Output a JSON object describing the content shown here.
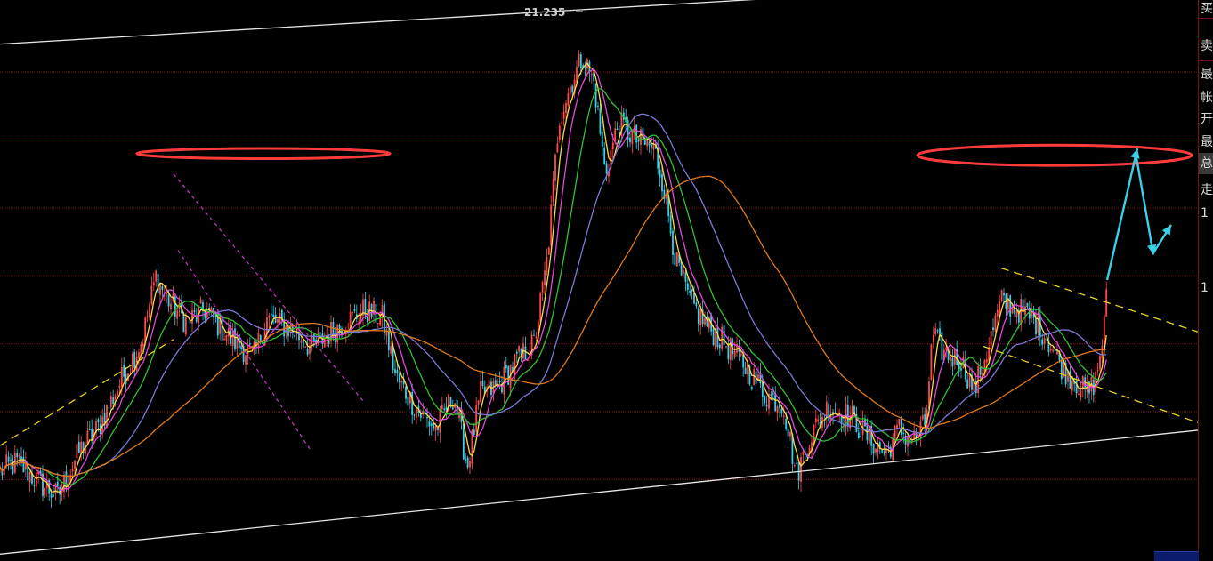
{
  "colors": {
    "background": "#000000",
    "grid": "#7a1010",
    "candle_up": "#ff4a4a",
    "candle_down": "#39d0e8",
    "ma_fast": "#ffd84a",
    "ma_magenta": "#e14ad8",
    "ma_green": "#33c033",
    "ma_slate": "#7a7ad8",
    "ma_orange": "#e07a1a",
    "channel_lines": "#e6e6e6",
    "ellipse": "#ff3b3b",
    "arrow": "#3ad0e8",
    "dashed_yellow": "#e6d21a",
    "dashed_magenta": "#c23ac2"
  },
  "chart_data": {
    "type": "candlestick",
    "peak_label": "21.235",
    "x_range": [
      0,
      1346
    ],
    "y_range": [
      15.0,
      21.6
    ],
    "grid_y": [
      20.75,
      19.95,
      19.15,
      18.35,
      17.55,
      16.75,
      15.95
    ],
    "price_key_points": [
      [
        0,
        16.05
      ],
      [
        20,
        16.15
      ],
      [
        45,
        15.9
      ],
      [
        65,
        15.75
      ],
      [
        90,
        16.3
      ],
      [
        110,
        16.55
      ],
      [
        140,
        17.2
      ],
      [
        160,
        17.6
      ],
      [
        175,
        18.35
      ],
      [
        190,
        18.05
      ],
      [
        210,
        17.8
      ],
      [
        230,
        17.95
      ],
      [
        260,
        17.6
      ],
      [
        285,
        17.4
      ],
      [
        300,
        17.85
      ],
      [
        330,
        17.7
      ],
      [
        350,
        17.5
      ],
      [
        380,
        17.75
      ],
      [
        410,
        17.95
      ],
      [
        430,
        17.85
      ],
      [
        445,
        17.15
      ],
      [
        470,
        16.75
      ],
      [
        490,
        16.55
      ],
      [
        510,
        16.95
      ],
      [
        525,
        16.1
      ],
      [
        540,
        16.95
      ],
      [
        560,
        17.05
      ],
      [
        580,
        17.35
      ],
      [
        600,
        17.55
      ],
      [
        615,
        18.55
      ],
      [
        628,
        20.2
      ],
      [
        645,
        20.7
      ],
      [
        655,
        20.95
      ],
      [
        668,
        20.6
      ],
      [
        680,
        19.55
      ],
      [
        695,
        20.15
      ],
      [
        715,
        19.95
      ],
      [
        735,
        19.85
      ],
      [
        745,
        19.45
      ],
      [
        760,
        18.5
      ],
      [
        775,
        18.05
      ],
      [
        795,
        17.75
      ],
      [
        815,
        17.55
      ],
      [
        840,
        17.25
      ],
      [
        860,
        16.95
      ],
      [
        880,
        16.85
      ],
      [
        895,
        16.0
      ],
      [
        910,
        16.45
      ],
      [
        930,
        16.8
      ],
      [
        955,
        16.7
      ],
      [
        975,
        16.45
      ],
      [
        995,
        16.25
      ],
      [
        1010,
        16.55
      ],
      [
        1025,
        16.4
      ],
      [
        1040,
        16.6
      ],
      [
        1048,
        17.65
      ],
      [
        1060,
        17.45
      ],
      [
        1080,
        17.35
      ],
      [
        1095,
        17.0
      ],
      [
        1110,
        17.5
      ],
      [
        1125,
        18.05
      ],
      [
        1145,
        17.95
      ],
      [
        1165,
        17.8
      ],
      [
        1180,
        17.55
      ],
      [
        1195,
        17.25
      ],
      [
        1210,
        17.1
      ],
      [
        1222,
        16.95
      ],
      [
        1232,
        17.15
      ],
      [
        1240,
        17.7
      ],
      [
        1244,
        18.15
      ]
    ],
    "moving_averages": [
      {
        "color_key": "ma_fast",
        "period": 5
      },
      {
        "color_key": "ma_magenta",
        "period": 10
      },
      {
        "color_key": "ma_green",
        "period": 20
      },
      {
        "color_key": "ma_slate",
        "period": 40
      },
      {
        "color_key": "ma_orange",
        "period": 80
      }
    ],
    "annotations": {
      "channel_top": [
        [
          0,
          21.08
        ],
        [
          870,
          21.62
        ]
      ],
      "channel_bottom": [
        [
          0,
          15.07
        ],
        [
          1346,
          16.53
        ]
      ],
      "ellipses": [
        {
          "cx": 296,
          "cy": 19.79,
          "rx": 142,
          "ry": 0.06
        },
        {
          "cx": 1185,
          "cy": 19.77,
          "rx": 154,
          "ry": 0.12
        }
      ],
      "dashed_yellow": [
        [
          [
            0,
            16.35
          ],
          [
            195,
            17.6
          ]
        ],
        [
          [
            1125,
            18.44
          ],
          [
            1346,
            17.69
          ]
        ],
        [
          [
            1105,
            17.52
          ],
          [
            1346,
            16.62
          ]
        ]
      ],
      "dashed_magenta": [
        [
          [
            195,
            19.55
          ],
          [
            410,
            16.85
          ]
        ],
        [
          [
            200,
            18.65
          ],
          [
            350,
            16.28
          ]
        ]
      ],
      "arrows": [
        [
          [
            1244,
            18.3
          ],
          [
            1278,
            19.85
          ]
        ],
        [
          [
            1276,
            19.8
          ],
          [
            1296,
            18.6
          ]
        ],
        [
          [
            1296,
            18.62
          ],
          [
            1316,
            18.95
          ]
        ]
      ]
    }
  },
  "side_panel": {
    "rows": [
      "买",
      "卖",
      "最",
      "帐",
      "开",
      "最",
      "总",
      "走",
      "1",
      "1"
    ]
  }
}
